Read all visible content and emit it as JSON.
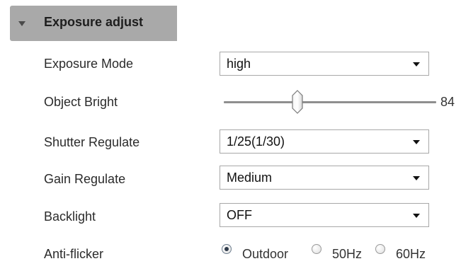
{
  "section": {
    "title": "Exposure adjust",
    "expanded": true
  },
  "exposure_mode": {
    "label": "Exposure Mode",
    "value": "high"
  },
  "object_bright": {
    "label": "Object Bright",
    "value": "84"
  },
  "shutter_regulate": {
    "label": "Shutter Regulate",
    "value": "1/25(1/30)"
  },
  "gain_regulate": {
    "label": "Gain Regulate",
    "value": "Medium"
  },
  "backlight": {
    "label": "Backlight",
    "value": "OFF"
  },
  "anti_flicker": {
    "label": "Anti-flicker",
    "options": [
      "Outdoor",
      "50Hz",
      "60Hz"
    ],
    "selected": "Outdoor"
  },
  "icons": {
    "collapse": "triangle-down-icon",
    "dropdown": "chevron-down-icon",
    "slider_thumb": "slider-thumb-icon"
  },
  "colors": {
    "header_bg": "#a9a9a9",
    "select_border": "#a8a8a8",
    "slider_track": "#8f8f8f"
  }
}
